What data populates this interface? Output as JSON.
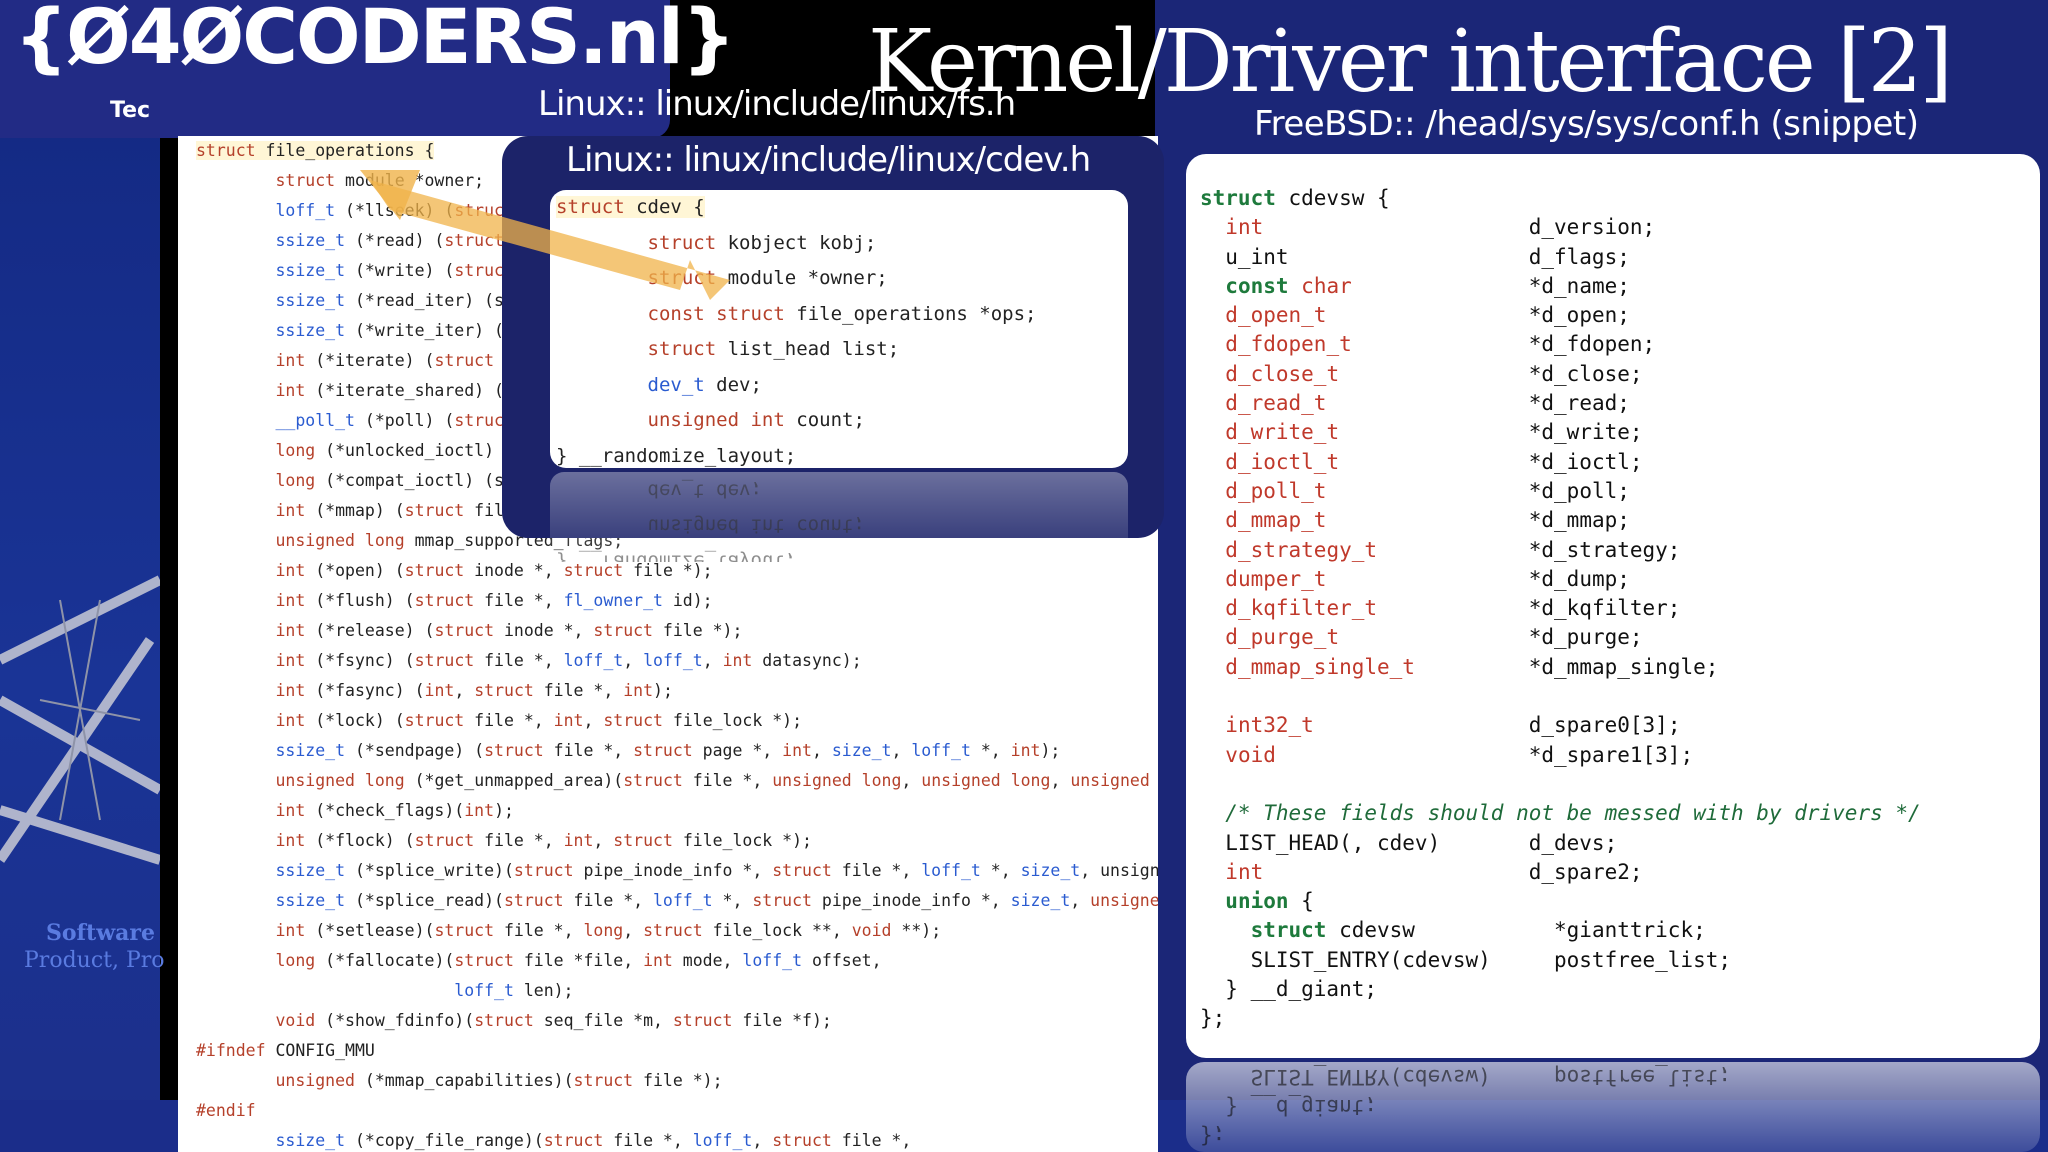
{
  "slide": {
    "title": "Kernel/Driver interface [2]",
    "logo": "{Ø4ØCODERS.nl}",
    "logo_sub": "Tec",
    "side_text_1": "Software",
    "side_text_2": "Product,  Pro"
  },
  "panels": {
    "fs": {
      "title": "Linux:: linux/include/linux/fs.h",
      "lines": [
        "struct file_operations {",
        "        struct module *owner;",
        "        loff_t (*llseek) (struct",
        "        ssize_t (*read) (struct",
        "        ssize_t (*write) (struct",
        "        ssize_t (*read_iter) (s",
        "        ssize_t (*write_iter) (",
        "        int (*iterate) (struct",
        "        int (*iterate_shared) (",
        "        __poll_t (*poll) (struct",
        "        long (*unlocked_ioctl)",
        "        long (*compat_ioctl) (s",
        "        int (*mmap) (struct fil",
        "        unsigned long mmap_supported_flags;",
        "        int (*open) (struct inode *, struct file *);",
        "        int (*flush) (struct file *, fl_owner_t id);",
        "        int (*release) (struct inode *, struct file *);",
        "        int (*fsync) (struct file *, loff_t, loff_t, int datasync);",
        "        int (*fasync) (int, struct file *, int);",
        "        int (*lock) (struct file *, int, struct file_lock *);",
        "        ssize_t (*sendpage) (struct file *, struct page *, int, size_t, loff_t *, int);",
        "        unsigned long (*get_unmapped_area)(struct file *, unsigned long, unsigned long, unsigned l",
        "        int (*check_flags)(int);",
        "        int (*flock) (struct file *, int, struct file_lock *);",
        "        ssize_t (*splice_write)(struct pipe_inode_info *, struct file *, loff_t *, size_t, unsigne",
        "        ssize_t (*splice_read)(struct file *, loff_t *, struct pipe_inode_info *, size_t, unsigned",
        "        int (*setlease)(struct file *, long, struct file_lock **, void **);",
        "        long (*fallocate)(struct file *file, int mode, loff_t offset,",
        "                          loff_t len);",
        "        void (*show_fdinfo)(struct seq_file *m, struct file *f);",
        "#ifndef CONFIG_MMU",
        "        unsigned (*mmap_capabilities)(struct file *);",
        "#endif",
        "        ssize_t (*copy_file_range)(struct file *, loff_t, struct file *,"
      ]
    },
    "cdev": {
      "title": "Linux:: linux/include/linux/cdev.h",
      "lines": [
        "struct cdev {",
        "        struct kobject kobj;",
        "        struct module *owner;",
        "        const struct file_operations *ops;",
        "        struct list_head list;",
        "        dev_t dev;",
        "        unsigned int count;",
        "} __randomize_layout;"
      ]
    },
    "freebsd": {
      "title": "FreeBSD:: /head/sys/sys/conf.h (snippet)",
      "lines": [
        "struct cdevsw {",
        "  int                     d_version;",
        "  u_int                   d_flags;",
        "  const char              *d_name;",
        "  d_open_t                *d_open;",
        "  d_fdopen_t              *d_fdopen;",
        "  d_close_t               *d_close;",
        "  d_read_t                *d_read;",
        "  d_write_t               *d_write;",
        "  d_ioctl_t               *d_ioctl;",
        "  d_poll_t                *d_poll;",
        "  d_mmap_t                *d_mmap;",
        "  d_strategy_t            *d_strategy;",
        "  dumper_t                *d_dump;",
        "  d_kqfilter_t            *d_kqfilter;",
        "  d_purge_t               *d_purge;",
        "  d_mmap_single_t         *d_mmap_single;",
        "",
        "  int32_t                 d_spare0[3];",
        "  void                    *d_spare1[3];",
        "",
        "  /* These fields should not be messed with by drivers */",
        "  LIST_HEAD(, cdev)       d_devs;",
        "  int                     d_spare2;",
        "  union {",
        "    struct cdevsw           *gianttrick;",
        "    SLIST_ENTRY(cdevsw)     postfree_list;",
        "  } __d_giant;",
        "};"
      ]
    }
  },
  "colors": {
    "keyword": "#b5402a",
    "type": "#2a5bd0",
    "freebsd_keyword": "#1e7a3c",
    "freebsd_type": "#c0392b",
    "arrow": "#f0b34a"
  }
}
